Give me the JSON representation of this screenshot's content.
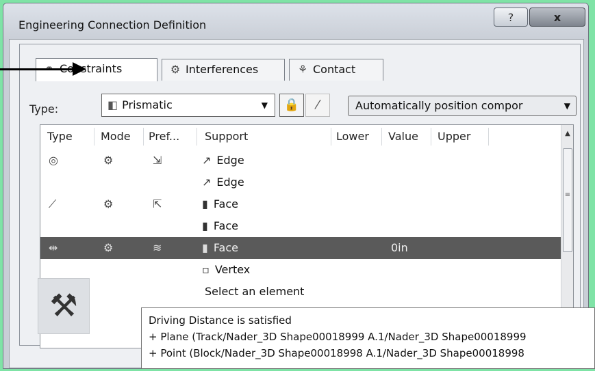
{
  "window": {
    "title": "Engineering Connection Definition",
    "help_label": "?",
    "close_label": "x"
  },
  "tabs": [
    {
      "label": "Constraints",
      "icon": "constraints-icon",
      "active": true
    },
    {
      "label": "Interferences",
      "icon": "interferences-icon",
      "active": false
    },
    {
      "label": "Contact",
      "icon": "contact-icon",
      "active": false
    }
  ],
  "type_row": {
    "label": "Type:",
    "selected_value": "Prismatic",
    "dropdown_glyph": "▼",
    "lock_icon": "lock-icon",
    "wand_icon": "magic-wand-icon",
    "auto_position_value": "Automatically position compor",
    "auto_dropdown_glyph": "▼"
  },
  "table": {
    "columns": [
      "Type",
      "Mode",
      "Pref...",
      "Support",
      "Lower",
      "Value",
      "Upper"
    ],
    "rows": [
      {
        "type_icon": "◎",
        "mode_icon": "⚙",
        "pref_icon": "⇲",
        "support_icon": "↗",
        "support": "Edge",
        "lower": "",
        "value": "",
        "upper": "",
        "selected": false
      },
      {
        "type_icon": "",
        "mode_icon": "",
        "pref_icon": "",
        "support_icon": "↗",
        "support": "Edge",
        "lower": "",
        "value": "",
        "upper": "",
        "selected": false
      },
      {
        "type_icon": "⟋",
        "mode_icon": "⚙",
        "pref_icon": "⇱",
        "support_icon": "▮",
        "support": "Face",
        "lower": "",
        "value": "",
        "upper": "",
        "selected": false
      },
      {
        "type_icon": "",
        "mode_icon": "",
        "pref_icon": "",
        "support_icon": "▮",
        "support": "Face",
        "lower": "",
        "value": "",
        "upper": "",
        "selected": false
      },
      {
        "type_icon": "⇹",
        "mode_icon": "⚙",
        "pref_icon": "≋",
        "support_icon": "▮",
        "support": "Face",
        "lower": "",
        "value": "0in",
        "upper": "",
        "selected": true
      },
      {
        "type_icon": "",
        "mode_icon": "",
        "pref_icon": "",
        "support_icon": "▫",
        "support": "Vertex",
        "lower": "",
        "value": "",
        "upper": "",
        "selected": false
      }
    ],
    "placeholder_row": "Select an element"
  },
  "scrollbar": {
    "up": "▲",
    "down": "▼",
    "grip": "≡"
  },
  "tool_icon": "engineering-tool-icon",
  "tooltip": {
    "line1": "Driving Distance is satisfied",
    "line2": "+ Plane (Track/Nader_3D Shape00018999 A.1/Nader_3D Shape00018999",
    "line3": "+ Point (Block/Nader_3D Shape00018998 A.1/Nader_3D Shape00018998"
  },
  "colors": {
    "background": "#7fe3a6",
    "selected_row": "#5a5a5a"
  }
}
